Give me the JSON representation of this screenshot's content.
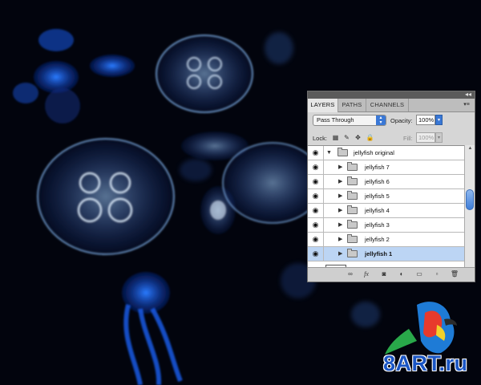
{
  "panel": {
    "tabs": [
      "LAYERS",
      "PATHS",
      "CHANNELS"
    ],
    "collapse_glyph": "◂◂",
    "menu_glyph": "▾≡",
    "blend_mode": "Pass Through",
    "opacity_label": "Opacity:",
    "opacity_value": "100%",
    "lock_label": "Lock:",
    "fill_label": "Fill:",
    "fill_value": "100%",
    "layers": [
      {
        "name": "jellyfish original",
        "type": "group-open",
        "visible": true
      },
      {
        "name": "jellyfish 7",
        "type": "group",
        "visible": true
      },
      {
        "name": "jellyfish 6",
        "type": "group",
        "visible": true
      },
      {
        "name": "jellyfish 5",
        "type": "group",
        "visible": true
      },
      {
        "name": "jellyfish 4",
        "type": "group",
        "visible": true
      },
      {
        "name": "jellyfish 3",
        "type": "group",
        "visible": true
      },
      {
        "name": "jellyfish 2",
        "type": "group",
        "visible": true
      },
      {
        "name": "jellyfish 1",
        "type": "group",
        "visible": true,
        "selected": true
      }
    ],
    "bottom_icons": [
      "link-icon",
      "fx-icon",
      "mask-icon",
      "adjustment-icon",
      "group-icon",
      "new-layer-icon",
      "trash-icon"
    ]
  },
  "watermark": {
    "text": "8ART.ru"
  },
  "colors": {
    "background": "#02040d",
    "jelly_glow": "#1f6dff",
    "selected_row": "#bcd5f4",
    "accent_blue": "#3a78d6"
  }
}
